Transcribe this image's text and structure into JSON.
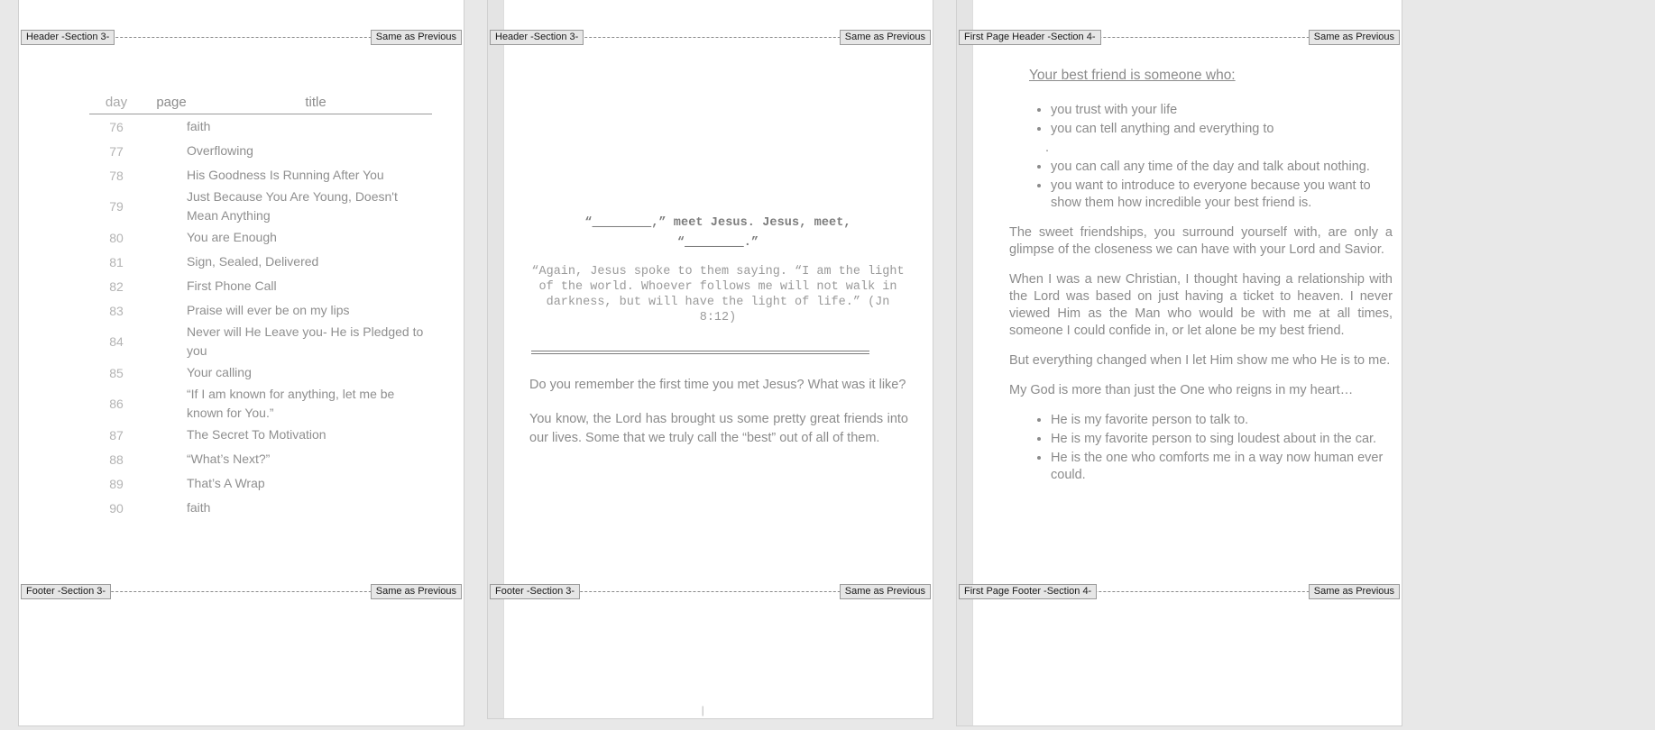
{
  "app": {
    "type": "word-processor-document-view",
    "zoom_layout": "three-page-side-by-side"
  },
  "markers": {
    "page1": {
      "header_left": "Header -Section 3-",
      "header_right": "Same as Previous",
      "footer_left": "Footer -Section 3-",
      "footer_right": "Same as Previous"
    },
    "page2": {
      "header_left": "Header -Section 3-",
      "header_right": "Same as Previous",
      "footer_left": "Footer -Section 3-",
      "footer_right": "Same as Previous"
    },
    "page3": {
      "header_left": "First Page Header -Section 4-",
      "header_right": "Same as Previous",
      "footer_left": "First Page Footer -Section 4-",
      "footer_right": "Same as Previous"
    }
  },
  "page1": {
    "table": {
      "headers": [
        "day",
        "page",
        "title"
      ],
      "rows": [
        {
          "day": "76",
          "page": "",
          "title": "faith"
        },
        {
          "day": "77",
          "page": "",
          "title": "Overflowing"
        },
        {
          "day": "78",
          "page": "",
          "title": "His Goodness Is Running After You"
        },
        {
          "day": "79",
          "page": "",
          "title": "Just Because You Are Young, Doesn't Mean Anything"
        },
        {
          "day": "80",
          "page": "",
          "title": "You are Enough"
        },
        {
          "day": "81",
          "page": "",
          "title": "Sign, Sealed, Delivered"
        },
        {
          "day": "82",
          "page": "",
          "title": "First Phone Call"
        },
        {
          "day": "83",
          "page": "",
          "title": "Praise will ever be on my lips"
        },
        {
          "day": "84",
          "page": "",
          "title": "Never will He Leave you- He is Pledged to   you"
        },
        {
          "day": "85",
          "page": "",
          "title": "Your calling"
        },
        {
          "day": "86",
          "page": "",
          "title": "“If I am known for anything, let me be known for You.”"
        },
        {
          "day": "87",
          "page": "",
          "title": "The Secret To Motivation"
        },
        {
          "day": "88",
          "page": "",
          "title": "“What’s Next?”"
        },
        {
          "day": "89",
          "page": "",
          "title": "That’s A Wrap"
        },
        {
          "day": "90",
          "page": "",
          "title": " faith"
        }
      ]
    }
  },
  "page2": {
    "title_line1_pre": "“",
    "title_blank1": "________",
    "title_line1_post": ",” meet Jesus. Jesus, meet,",
    "title_line2_pre": "“",
    "title_blank2": "________",
    "title_line2_post": ".”",
    "verse": "“Again, Jesus spoke to them saying. “I am the light of the world. Whoever follows me will not walk in darkness, but will have the light of life.” (Jn 8:12)",
    "question": "Do you remember the first time you met Jesus? What was it like?",
    "paragraph": "You know, the Lord has brought us some pretty great friends into our lives. Some that we truly call the “best” out of all of them."
  },
  "page3": {
    "heading": "Your best friend is someone who:",
    "bullets_top": [
      "you trust with your life",
      "you can tell anything and everything to",
      ".",
      "you can call any time of the day and talk about nothing.",
      "you want to introduce to everyone because you want to show them how incredible your best friend is."
    ],
    "paragraphs": [
      "The sweet friendships, you surround yourself with, are only a glimpse of the closeness we can have with your Lord and Savior.",
      "When I was a new Christian, I thought having a relationship with the Lord was based on just having a ticket to heaven.  I never viewed Him as the Man who would be with me at all times, someone I could confide in, or let alone be my best friend.",
      "But everything changed when I let Him show me who He is to me.",
      "My God is more than just the One who reigns in my heart…"
    ],
    "bullets_bottom": [
      "He is my favorite person to talk to.",
      "He is my favorite person to sing loudest about in the car.",
      "He is the one who comforts me in a way now human ever could."
    ]
  }
}
